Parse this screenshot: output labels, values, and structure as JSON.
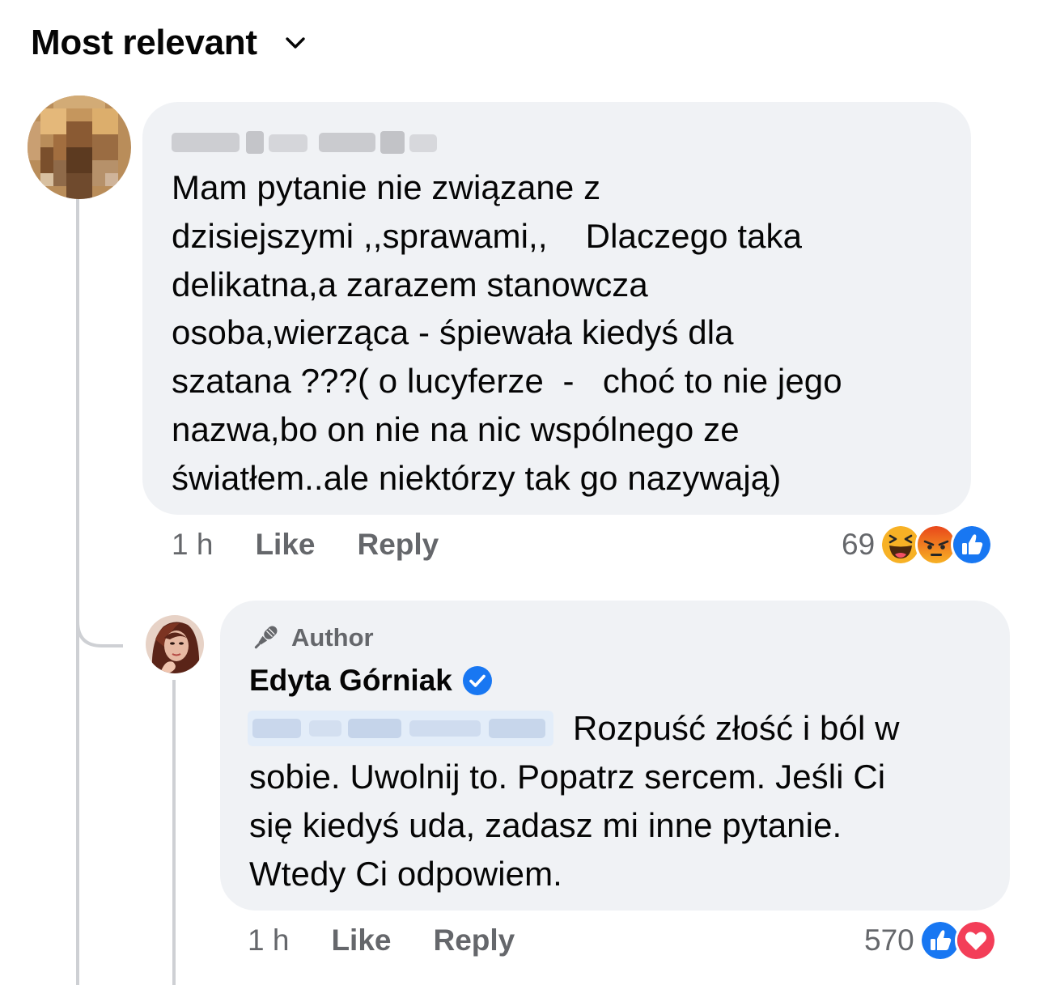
{
  "sort": {
    "label": "Most relevant",
    "icon": "chevron-down-icon"
  },
  "comment": {
    "author_name_blurred": true,
    "lines": [
      "Mam pytanie nie związane z",
      "dzisiejszymi ,,sprawami,,    Dlaczego taka",
      "delikatna,a zarazem stanowcza",
      "osoba,wierząca - śpiewała kiedyś dla",
      "szatana ???( o lucyferze  -   choć to nie jego",
      "nazwa,bo on nie na nic wspólnego ze",
      "światłem..ale niektórzy tak go nazywają)"
    ],
    "time": "1 h",
    "like_label": "Like",
    "reply_label": "Reply",
    "reaction_count": "69",
    "reactions": [
      "haha-icon",
      "angry-icon",
      "like-icon"
    ]
  },
  "reply": {
    "badge_label": "Author",
    "author_name": "Edyta Górniak",
    "verified": true,
    "first_line_text": "Rozpuść złość i ból w",
    "lines": [
      "sobie. Uwolnij to. Popatrz sercem. Jeśli Ci",
      "się kiedyś uda, zadasz mi inne pytanie.",
      "Wtedy Ci odpowiem."
    ],
    "time": "1 h",
    "like_label": "Like",
    "reply_label": "Reply",
    "reaction_count": "570",
    "reactions": [
      "like-icon",
      "love-icon"
    ]
  },
  "colors": {
    "bubble": "#f0f2f5",
    "meta_text": "#65676b",
    "like_blue": "#1877f2",
    "love_red": "#f33e58",
    "haha_yellow": "#f7b125",
    "angry_orange": "#e9710f"
  }
}
